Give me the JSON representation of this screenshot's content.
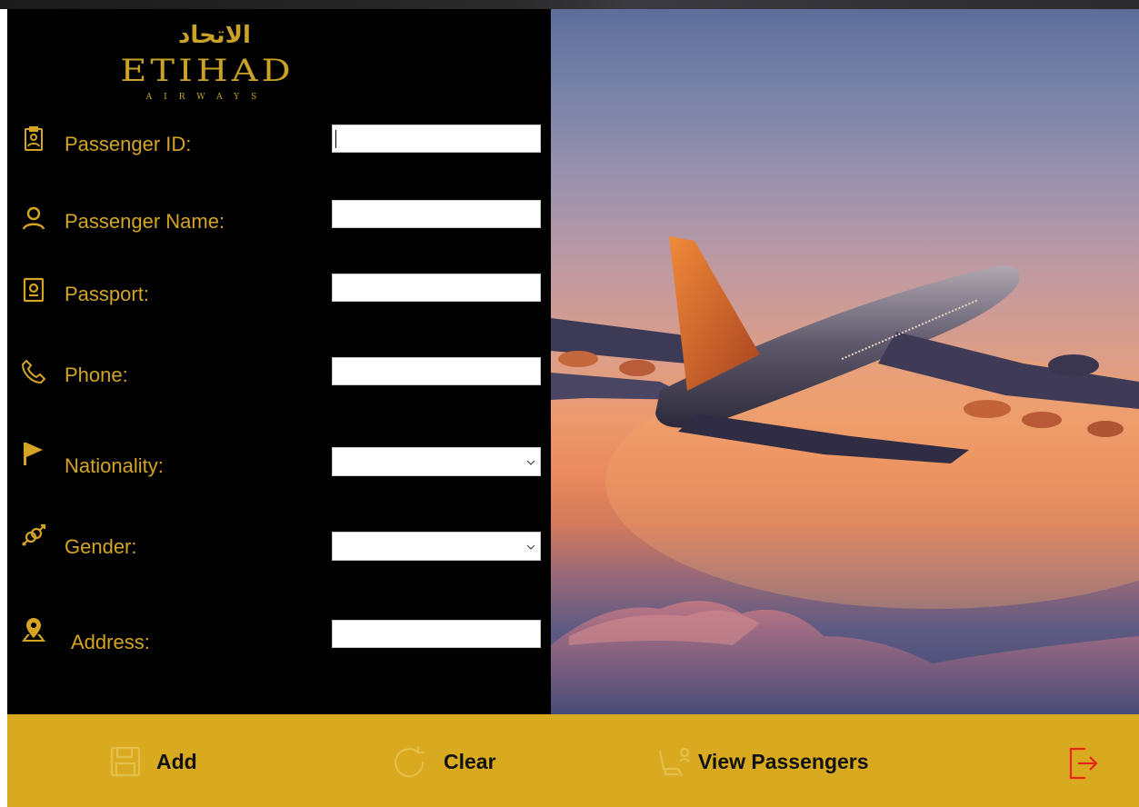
{
  "logo": {
    "arabic": "الاتحاد",
    "wordmark": "ETIHAD",
    "subtitle": "AIRWAYS"
  },
  "form": {
    "fields": [
      {
        "label": "Passenger ID:",
        "value": "",
        "icon": "id-badge-icon"
      },
      {
        "label": "Passenger Name:",
        "value": "",
        "icon": "person-icon"
      },
      {
        "label": "Passport:",
        "value": "",
        "icon": "passport-icon"
      },
      {
        "label": "Phone:",
        "value": "",
        "icon": "phone-icon"
      },
      {
        "label": "Nationality:",
        "value": "",
        "icon": "flag-icon"
      },
      {
        "label": "Gender:",
        "value": "",
        "icon": "gender-icon"
      },
      {
        "label": "Address:",
        "value": "",
        "icon": "location-pin-icon"
      }
    ]
  },
  "actions": {
    "add": "Add",
    "clear": "Clear",
    "view": "View Passengers",
    "exit_icon": "exit-icon"
  },
  "colors": {
    "accent_gold": "#d4a525",
    "bar_gold": "#d9a920",
    "panel_black": "#000000",
    "exit_red": "#e8251b"
  }
}
